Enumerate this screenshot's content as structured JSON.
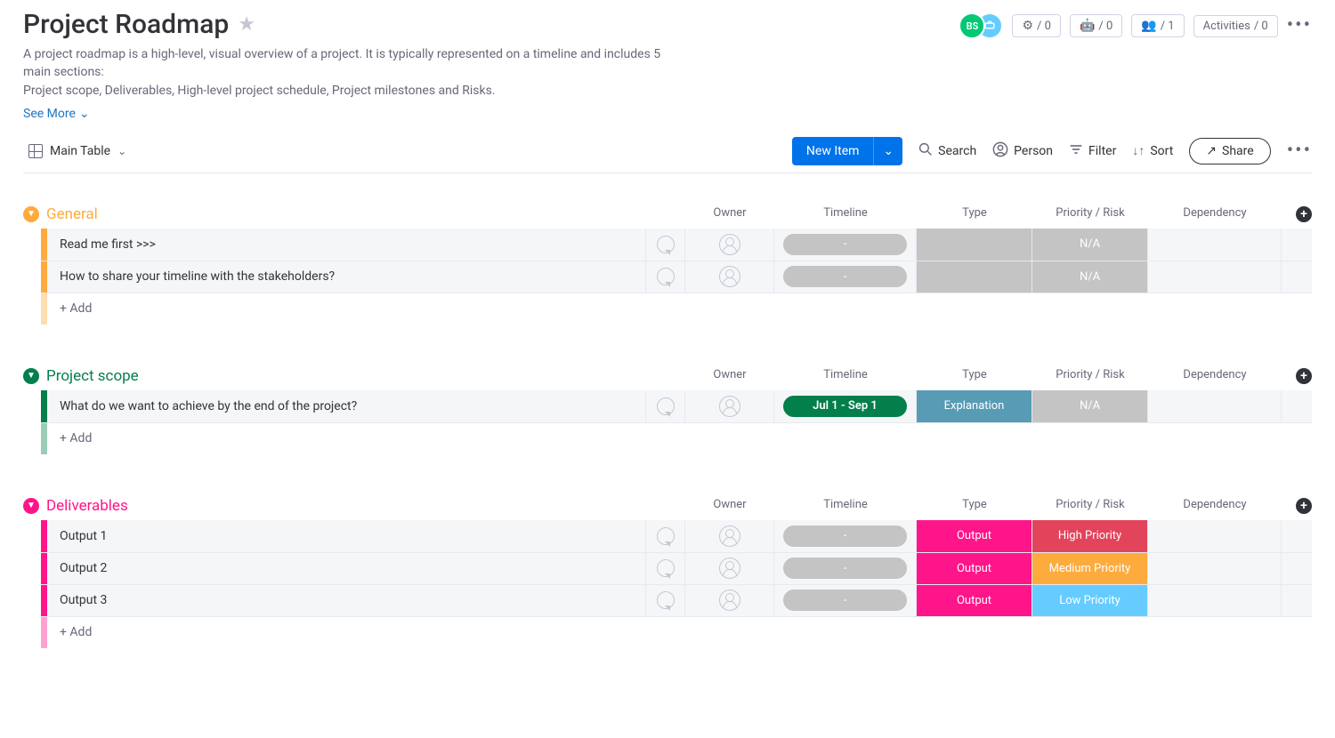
{
  "header": {
    "title": "Project Roadmap",
    "desc_line1": "A project roadmap is a high-level, visual overview of a project. It is typically represented on a timeline and includes 5 main sections:",
    "desc_line2": "Project scope, Deliverables, High-level project schedule, Project milestones and Risks.",
    "see_more": "See More",
    "avatars": {
      "a": "BS",
      "b_icon": "link-icon"
    },
    "pills": {
      "integrations": "/ 0",
      "automations": "/ 0",
      "members": "/ 1",
      "activities_label": "Activities",
      "activities": "/ 0"
    }
  },
  "toolbar": {
    "view_label": "Main Table",
    "new_item": "New Item",
    "search": "Search",
    "person": "Person",
    "filter": "Filter",
    "sort": "Sort",
    "share": "Share"
  },
  "columns": {
    "owner": "Owner",
    "timeline": "Timeline",
    "type": "Type",
    "priority": "Priority / Risk",
    "dependency": "Dependency"
  },
  "add_row_label": "+ Add",
  "groups": [
    {
      "title": "General",
      "color": "#fdab3d",
      "items": [
        {
          "name": "Read me first >>>",
          "timeline": "-",
          "timeline_class": "tl-grey",
          "type": "",
          "type_class": "cell-grey",
          "priority": "N/A",
          "priority_class": "cell-grey"
        },
        {
          "name": "How to share your timeline with the stakeholders?",
          "timeline": "-",
          "timeline_class": "tl-grey",
          "type": "",
          "type_class": "cell-grey",
          "priority": "N/A",
          "priority_class": "cell-grey"
        }
      ]
    },
    {
      "title": "Project scope",
      "color": "#037f4c",
      "items": [
        {
          "name": "What do we want to achieve by the end of the project?",
          "timeline": "Jul 1 - Sep 1",
          "timeline_class": "tl-green",
          "type": "Explanation",
          "type_class": "cell-blue",
          "priority": "N/A",
          "priority_class": "cell-grey"
        }
      ]
    },
    {
      "title": "Deliverables",
      "color": "#ff158a",
      "items": [
        {
          "name": "Output 1",
          "timeline": "-",
          "timeline_class": "tl-grey",
          "type": "Output",
          "type_class": "cell-pink",
          "priority": "High Priority",
          "priority_class": "cell-red"
        },
        {
          "name": "Output 2",
          "timeline": "-",
          "timeline_class": "tl-grey",
          "type": "Output",
          "type_class": "cell-pink",
          "priority": "Medium Priority",
          "priority_class": "cell-orange"
        },
        {
          "name": "Output 3",
          "timeline": "-",
          "timeline_class": "tl-grey",
          "type": "Output",
          "type_class": "cell-pink",
          "priority": "Low Priority",
          "priority_class": "cell-lightblue"
        }
      ]
    }
  ]
}
